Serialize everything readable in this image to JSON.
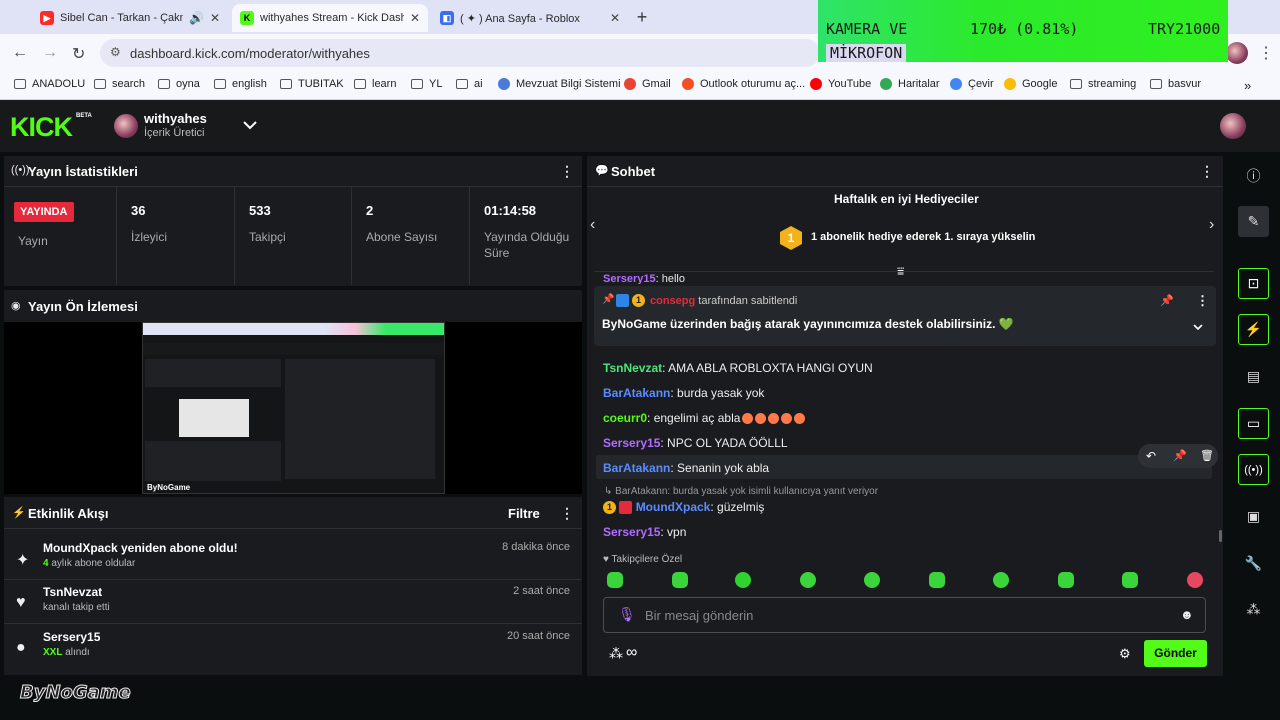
{
  "tabs": [
    {
      "title": "Sibel Can - Tarkan - Çakmak",
      "active": false,
      "fav_color": "#ff2a2a"
    },
    {
      "title": "withyahes Stream - Kick Dashbo",
      "active": true,
      "fav_color": "#53fc18"
    },
    {
      "title": "( ✦ ) Ana Sayfa - Roblox",
      "active": false,
      "fav_color": "#3a6df0"
    }
  ],
  "browser": {
    "url": "dashboard.kick.com/moderator/withyahes",
    "bookmarks": [
      "ANADOLU",
      "search",
      "oyna",
      "english",
      "TUBITAK",
      "learn",
      "YL",
      "ai",
      "Mevzuat Bilgi Sistemi",
      "Gmail",
      "Outlook oturumu aç...",
      "YouTube",
      "Haritalar",
      "Çevir",
      "Google",
      "streaming",
      "basvur"
    ]
  },
  "overlay": {
    "line1": "KAMERA VE",
    "line2": "MİKROFON",
    "percent": "170₺ (0.81%)",
    "total": "TRY21000"
  },
  "header": {
    "logo": "KICK",
    "beta": "BETA",
    "username": "withyahes",
    "role": "İçerik Üretici"
  },
  "stats": {
    "title": "Yayın İstatistikleri",
    "live_badge": "YAYINDA",
    "live_label": "Yayın",
    "items": [
      {
        "value": "36",
        "label": "İzleyici"
      },
      {
        "value": "533",
        "label": "Takipçi"
      },
      {
        "value": "2",
        "label": "Abone Sayısı"
      },
      {
        "value": "01:14:58",
        "label": "Yayında Olduğu Süre"
      }
    ]
  },
  "preview": {
    "title": "Yayın Ön İzlemesi",
    "watermark": "ByNoGame"
  },
  "activity": {
    "title": "Etkinlik Akışı",
    "filter": "Filtre",
    "items": [
      {
        "title": "MoundXpack yeniden abone oldu!",
        "sub_strong": "4",
        "sub": " aylık abone oldular",
        "time": "8 dakika önce",
        "icon": "sparkle-icon"
      },
      {
        "title": "TsnNevzat",
        "sub_strong": "",
        "sub": "kanalı takip etti",
        "time": "2 saat önce",
        "icon": "heart-icon"
      },
      {
        "title": "Sersery15",
        "sub_strong": "XXL",
        "sub": " alındı",
        "time": "20 saat önce",
        "icon": "gift-icon"
      }
    ]
  },
  "chat": {
    "title": "Sohbet",
    "gifters_title": "Haftalık en iyi Hediyeciler",
    "gifters_rank": "1",
    "gifters_text": "1 abonelik hediye ederek 1. sıraya yükselin",
    "partial_msg": {
      "user": "Sersery15",
      "text": ": hello"
    },
    "pinned": {
      "by_user": "consepg",
      "by_text": "tarafından sabitlendi",
      "message": "ByNoGame üzerinden bağış atarak yayınıncımıza destek olabilirsiniz. 💚"
    },
    "messages": [
      {
        "user": "TsnNevzat",
        "color": "#4ee37a",
        "text": ": AMA ABLA ROBLOXTA HANGI OYUN"
      },
      {
        "user": "BarAtakann",
        "color": "#5b8cff",
        "text": ": burda yasak yok"
      },
      {
        "user": "coeurr0",
        "color": "#53fc18",
        "text": ": engelimi aç abla"
      },
      {
        "user": "Sersery15",
        "color": "#b46bff",
        "text": ": NPC OL YADA ÖÖLLL"
      },
      {
        "user": "BarAtakann",
        "color": "#5b8cff",
        "text": ": Senanin yok abla"
      }
    ],
    "reply_hint": "BarAtakann: burda yasak yok isimli kullanıcıya yanıt veriyor",
    "reply_msg": {
      "user": "MoundXpack",
      "color": "#5b8cff",
      "text": ": güzelmiş",
      "badge": "1"
    },
    "last_msg": {
      "user": "Sersery15",
      "color": "#b46bff",
      "text": ": vpn"
    },
    "followers_only": "Takipçilere Özel",
    "input_placeholder": "Bir mesaj gönderin",
    "send_label": "Gönder",
    "infinity": "∞"
  },
  "colors": {
    "accent": "#53fc18",
    "live": "#e52b3b",
    "panel": "#191b1f"
  },
  "watermark": "ByNoGame"
}
